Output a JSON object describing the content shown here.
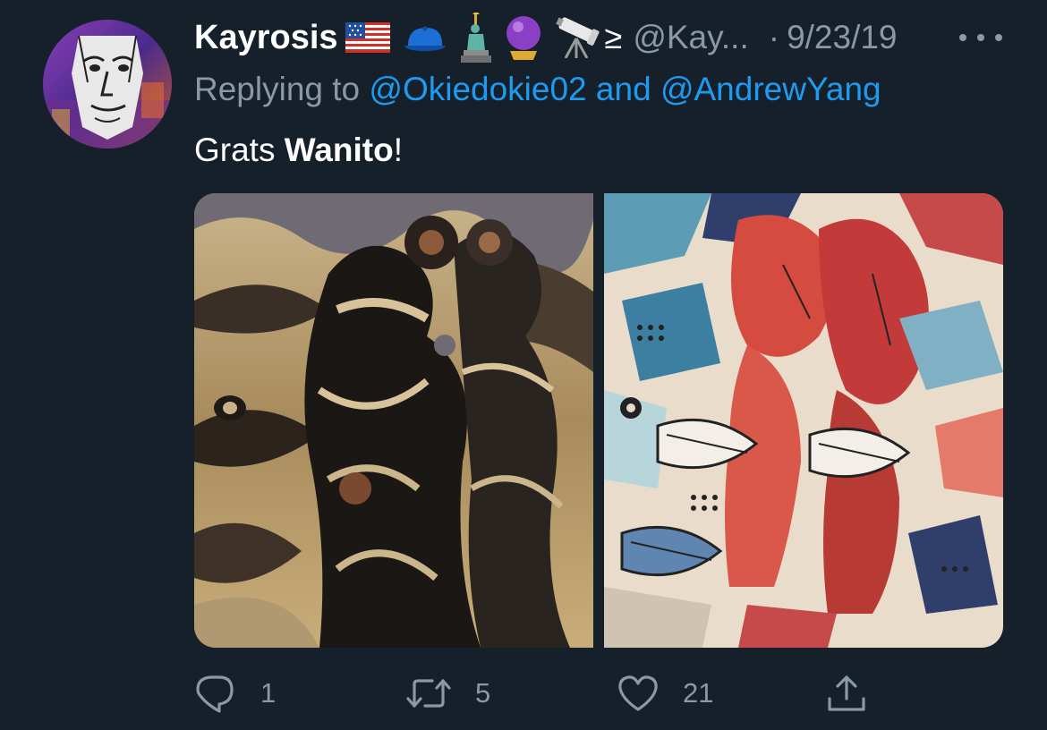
{
  "tweet": {
    "display_name": "Kayrosis",
    "name_emojis": [
      "us-flag-icon",
      "blue-cap-icon",
      "statue-of-liberty-icon",
      "crystal-ball-icon",
      "telescope-icon"
    ],
    "ge_symbol": "≥",
    "handle": "@Kay...",
    "separator": "·",
    "date": "9/23/19",
    "replying_prefix": "Replying to",
    "reply_mention_1": "@Okiedokie02",
    "reply_and": "and",
    "reply_mention_2": "@AndrewYang",
    "text_plain": "Grats",
    "text_bold": "Wanito",
    "text_end": "!",
    "media": [
      {
        "name": "stylized-photo-sepia-swirl"
      },
      {
        "name": "stylized-photo-abstract-red-blue"
      }
    ],
    "actions": {
      "reply_count": "1",
      "retweet_count": "5",
      "like_count": "21"
    },
    "colors": {
      "background": "#15202b",
      "secondary_text": "#8b98a5",
      "link": "#1d9bf0"
    }
  }
}
